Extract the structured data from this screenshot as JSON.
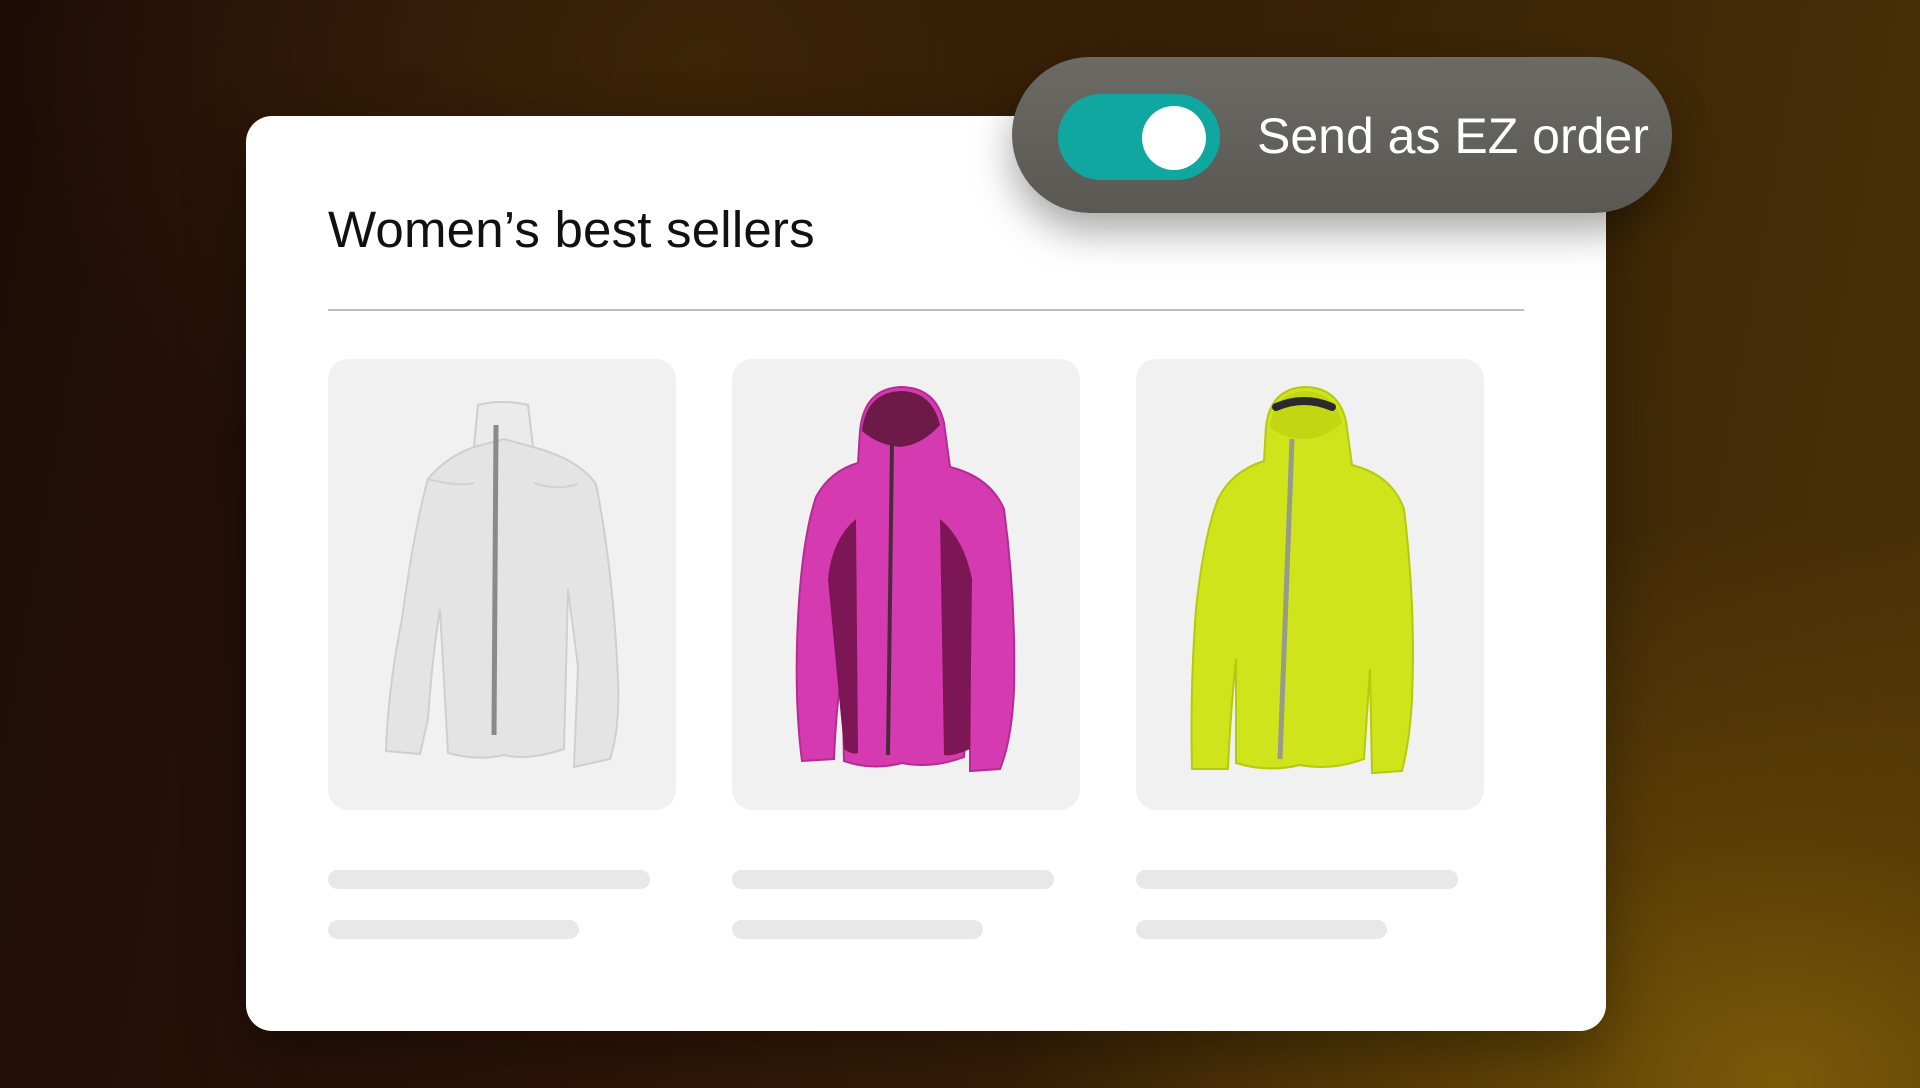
{
  "card": {
    "title": "Women’s best sellers",
    "products": [
      {
        "name": "white-jacket",
        "color": "#e6e6e6",
        "accent": "#8a8a8a"
      },
      {
        "name": "magenta-jacket",
        "color": "#d63ab0",
        "accent": "#7d1655"
      },
      {
        "name": "lime-jacket",
        "color": "#cfe41a",
        "accent": "#a8b80f"
      }
    ]
  },
  "toggle": {
    "label": "Send as EZ order",
    "state": "on",
    "on_color": "#0fa7a0"
  }
}
